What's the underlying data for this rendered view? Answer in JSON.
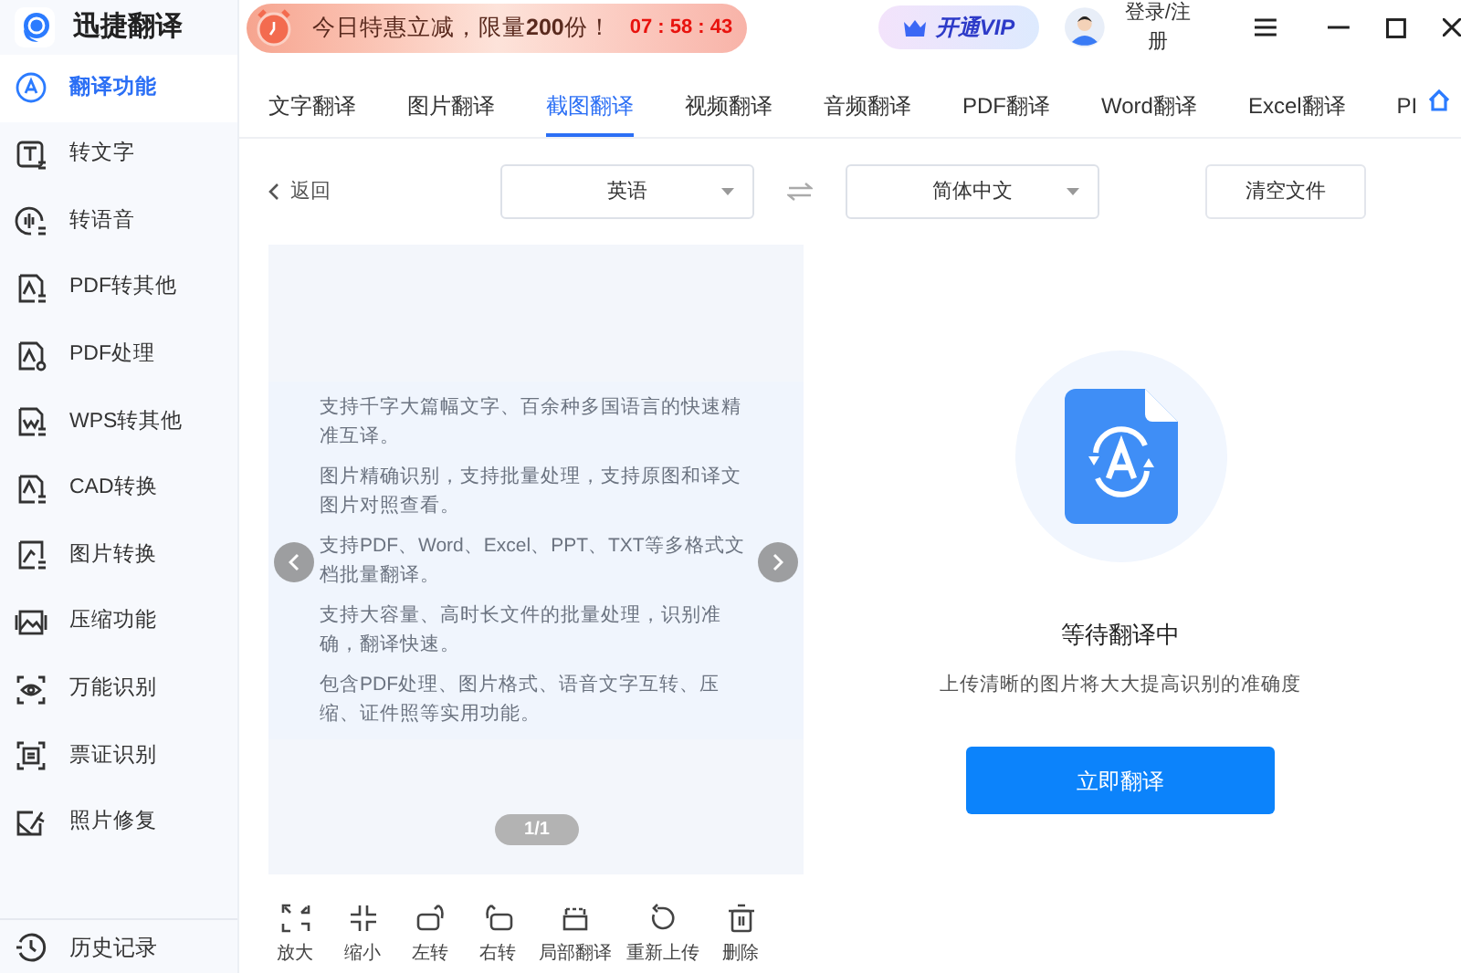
{
  "app": {
    "title": "迅捷翻译"
  },
  "promo": {
    "text": "今日特惠立减，限量**200**份！",
    "countdown": "07 : 58 : 43"
  },
  "header": {
    "vip": "开通VIP",
    "login": "登录/注册"
  },
  "sidebar": {
    "items": [
      {
        "label": "翻译功能",
        "selected": true
      },
      {
        "label": "转文字",
        "selected": false
      },
      {
        "label": "转语音",
        "selected": false
      },
      {
        "label": "PDF转其他",
        "selected": false
      },
      {
        "label": "PDF处理",
        "selected": false
      },
      {
        "label": "WPS转其他",
        "selected": false
      },
      {
        "label": "CAD转换",
        "selected": false
      },
      {
        "label": "图片转换",
        "selected": false
      },
      {
        "label": "压缩功能",
        "selected": false
      },
      {
        "label": "万能识别",
        "selected": false
      },
      {
        "label": "票证识别",
        "selected": false
      },
      {
        "label": "照片修复",
        "selected": false
      }
    ],
    "history": "历史记录"
  },
  "tabs": [
    {
      "label": "文字翻译",
      "selected": false
    },
    {
      "label": "图片翻译",
      "selected": false
    },
    {
      "label": "截图翻译",
      "selected": true
    },
    {
      "label": "视频翻译",
      "selected": false
    },
    {
      "label": "音频翻译",
      "selected": false
    },
    {
      "label": "PDF翻译",
      "selected": false
    },
    {
      "label": "Word翻译",
      "selected": false
    },
    {
      "label": "Excel翻译",
      "selected": false
    },
    {
      "label": "PI",
      "selected": false
    }
  ],
  "toolbar": {
    "back": "返回",
    "source_language": "英语",
    "target_language": "简体中文",
    "clear": "清空文件"
  },
  "preview": {
    "paragraphs": [
      "支持千字大篇幅文字、百余种多国语言的快速精准互译。",
      "图片精确识别，支持批量处理，支持原图和译文图片对照查看。",
      "支持PDF、Word、Excel、PPT、TXT等多格式文档批量翻译。",
      "支持大容量、高时长文件的批量处理，识别准确，翻译快速。",
      "包含PDF处理、图片格式、语音文字互转、压缩、证件照等实用功能。"
    ],
    "page": "1/1"
  },
  "tools": [
    "放大",
    "缩小",
    "左转",
    "右转",
    "局部翻译",
    "重新上传",
    "删除"
  ],
  "result": {
    "title": "等待翻译中",
    "hint": "上传清晰的图片将大大提高识别的准确度",
    "button": "立即翻译"
  }
}
